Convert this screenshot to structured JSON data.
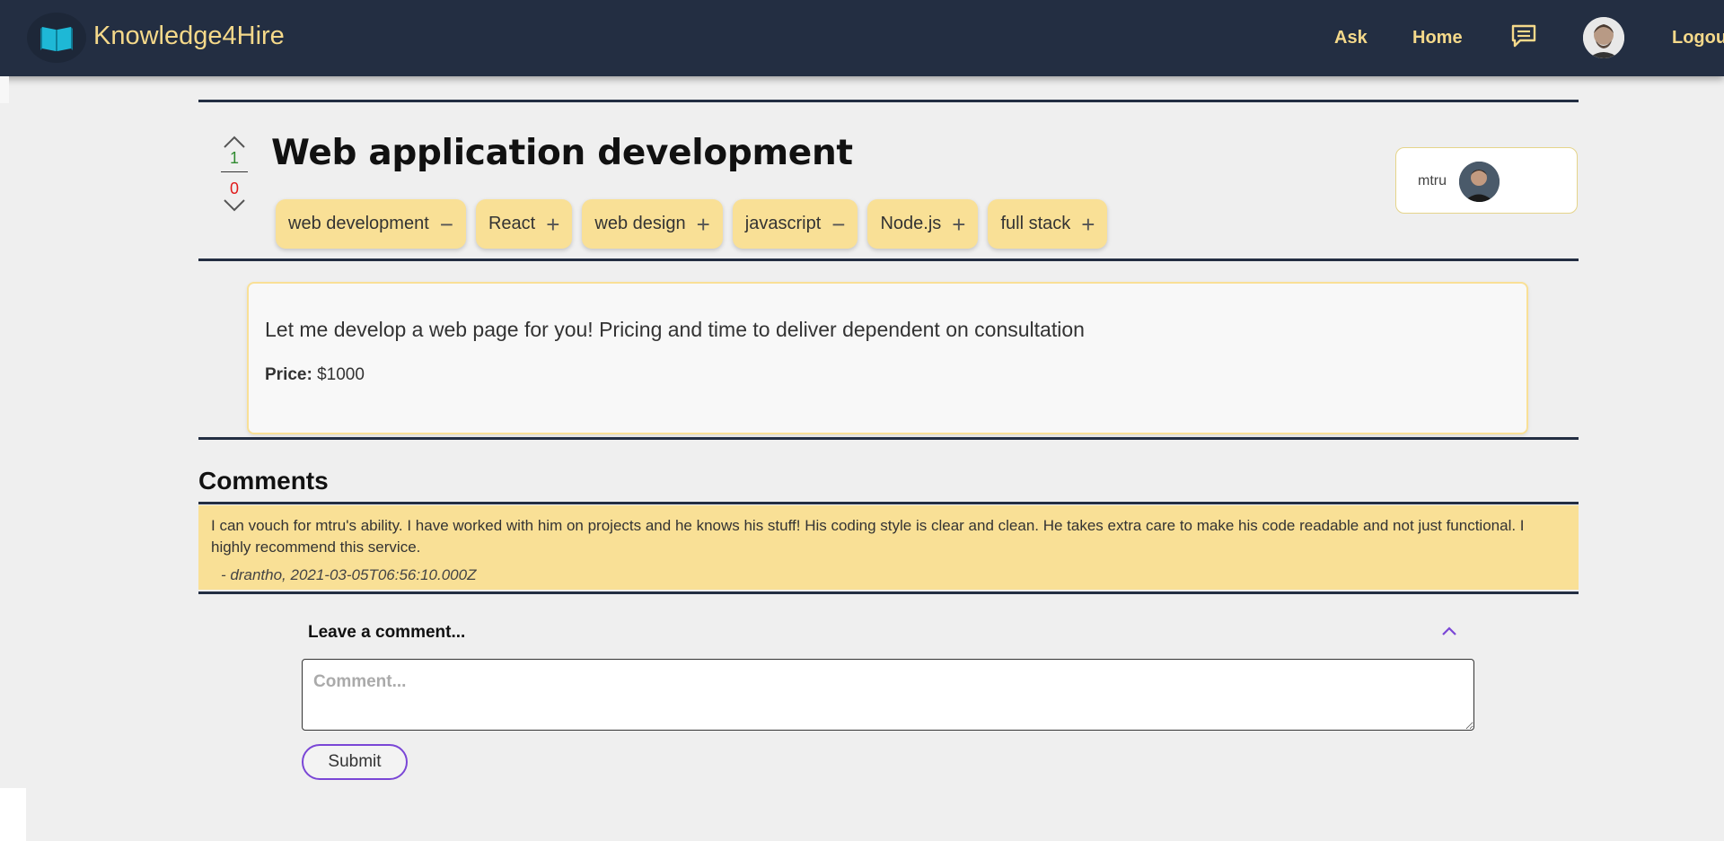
{
  "navbar": {
    "brand": "Knowledge4Hire",
    "links": {
      "ask": "Ask",
      "home": "Home",
      "logout": "Logout"
    },
    "icons": {
      "logo": "open-book-icon",
      "messages": "chat-bubble-icon",
      "avatar": "user-avatar"
    }
  },
  "post": {
    "title": "Web application development",
    "votes": {
      "up": "1",
      "down": "0"
    },
    "tags": [
      {
        "label": "web development",
        "action": "−"
      },
      {
        "label": "React",
        "action": "+"
      },
      {
        "label": "web design",
        "action": "+"
      },
      {
        "label": "javascript",
        "action": "−"
      },
      {
        "label": "Node.js",
        "action": "+"
      },
      {
        "label": "full stack",
        "action": "+"
      }
    ],
    "author": {
      "name": "mtru"
    },
    "description": "Let me develop a web page for you! Pricing and time to deliver dependent on consultation",
    "price_label": "Price:",
    "price_value": "$1000"
  },
  "comments": {
    "title": "Comments",
    "items": [
      {
        "text": "I can vouch for mtru's ability. I have worked with him on projects and he knows his stuff! His coding style is clear and clean. He takes extra care to make his code readable and not just functional. I highly recommend this service.",
        "meta": "- drantho, 2021-03-05T06:56:10.000Z"
      }
    ],
    "form": {
      "header": "Leave a comment...",
      "placeholder": "Comment...",
      "submit": "Submit"
    }
  },
  "colors": {
    "navbar": "#232e42",
    "accent_yellow": "#f9e096",
    "brand_text": "#f5d98a",
    "upvote": "#2f8a2f",
    "downvote": "#e01a1a",
    "submit_border": "#7a46d6"
  }
}
